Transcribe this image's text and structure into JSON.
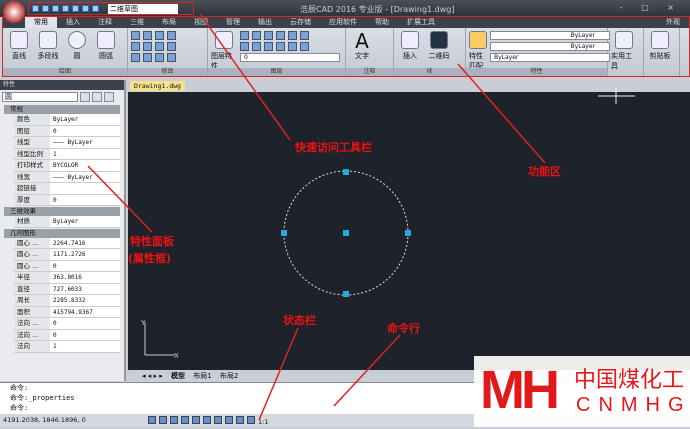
{
  "titlebar": {
    "workspace": "二维草图",
    "title": "浩辰CAD 2016 专业版 - [Drawing1.dwg]",
    "window_controls": "- □ ×"
  },
  "ribbon": {
    "tabs": [
      "常用",
      "插入",
      "注释",
      "三维",
      "布局",
      "视图",
      "管理",
      "输出",
      "云存储",
      "应用软件",
      "帮助",
      "扩展工具"
    ],
    "appearance": "外观",
    "draw": {
      "tools": [
        "直线",
        "多段线",
        "圆",
        "圆弧"
      ],
      "label": "绘图"
    },
    "modify": {
      "label": "修改"
    },
    "layer": {
      "tool": "图层特性",
      "combo": "0",
      "label": "图层"
    },
    "annotation": {
      "tool": "文字",
      "label": "注释"
    },
    "block": {
      "tools": [
        "插入",
        "二维码"
      ],
      "label": "块"
    },
    "properties": {
      "tool": "特性匹配",
      "linetype": "ByLayer",
      "lineweight": "ByLayer",
      "color": "ByLayer",
      "label": "特性"
    },
    "utilities": "实用工具",
    "clipboard": "剪贴板"
  },
  "properties_panel": {
    "title": "特性",
    "selection": "圆",
    "sections": [
      {
        "name": "常规",
        "rows": [
          [
            "颜色",
            "ByLayer"
          ],
          [
            "图层",
            "0"
          ],
          [
            "线型",
            "——— ByLayer"
          ],
          [
            "线型比例",
            "1"
          ],
          [
            "打印样式",
            "BYCOLOR"
          ],
          [
            "线宽",
            "——— ByLayer"
          ],
          [
            "超链接",
            ""
          ],
          [
            "厚度",
            "0"
          ]
        ]
      },
      {
        "name": "三维效果",
        "rows": [
          [
            "材质",
            "ByLayer"
          ]
        ]
      },
      {
        "name": "几何图形",
        "rows": [
          [
            "圆心 ...",
            "2264.7416"
          ],
          [
            "圆心 ...",
            "1171.2726"
          ],
          [
            "圆心 ...",
            "0"
          ],
          [
            "半径",
            "363.8016"
          ],
          [
            "直径",
            "727.6033"
          ],
          [
            "周长",
            "2285.8332"
          ],
          [
            "面积",
            "415794.9367"
          ],
          [
            "法向 ...",
            "0"
          ],
          [
            "法向 ...",
            "0"
          ],
          [
            "法向",
            "1"
          ]
        ]
      }
    ]
  },
  "document_tab": "Drawing1.dwg",
  "layout_tabs": [
    "模型",
    "布局1",
    "布局2"
  ],
  "command_lines": [
    "命令:",
    "命令:_properties",
    "命令:"
  ],
  "status": {
    "coords": "4191.2038, 1846.1896, 0",
    "scale": "1:1"
  },
  "annotations": {
    "qat": "快速访问工具栏",
    "ribbon": "功能区",
    "props1": "特性面板",
    "props2": "(属性框)",
    "status": "状态栏",
    "cmd": "命令行"
  },
  "watermark": {
    "logo": "MH",
    "cn": "中国煤化工",
    "en": "CNMHG"
  }
}
